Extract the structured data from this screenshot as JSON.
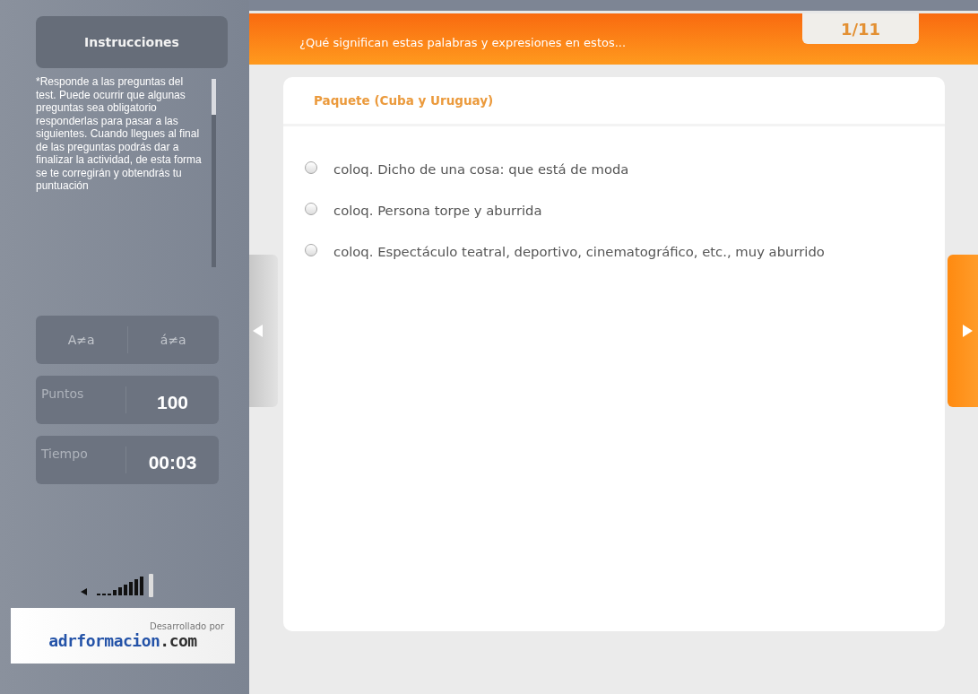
{
  "sidebar": {
    "title": "Instrucciones",
    "instructions": "*Responde a las preguntas del test. Puede ocurrir que algunas preguntas sea obligatorio responderlas para pasar a las siguientes. Cuando llegues al final de las preguntas podrás dar a finalizar la actividad, de esta forma se te corregirán y obtendrás tu puntuación",
    "toggles": [
      {
        "label": "A≠a"
      },
      {
        "label": "á≠a"
      }
    ],
    "stats": [
      {
        "label": "Puntos",
        "value": "100"
      },
      {
        "label": "Tiempo",
        "value": "00:03"
      }
    ],
    "credit": {
      "tagline": "Desarrollado por",
      "name": "adrformacion",
      "suffix": ".com"
    }
  },
  "header": {
    "title": "¿Qué significan estas palabras y expresiones en estos...",
    "counter": "1/11"
  },
  "question": {
    "term": "Paquete (Cuba y Uruguay)",
    "options": [
      {
        "text": "coloq. Dicho de una cosa: que está de moda",
        "selected": false
      },
      {
        "text": "coloq. Persona torpe y aburrida",
        "selected": false
      },
      {
        "text": "coloq. Espectáculo teatral, deportivo, cinematográfico, etc., muy aburrido",
        "selected": false
      }
    ]
  }
}
